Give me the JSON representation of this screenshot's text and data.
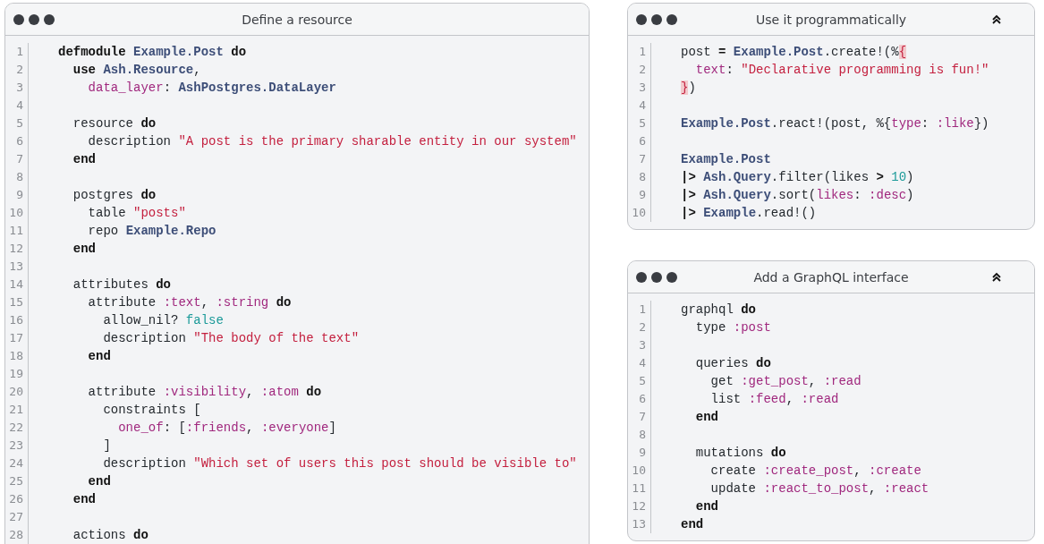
{
  "panels": [
    {
      "title": "Define a resource",
      "collapsible": false,
      "lines": [
        {
          "number": "1",
          "tokens": [
            {
              "kind": "keyword",
              "text": "defmodule "
            },
            {
              "kind": "module",
              "text": "Example.Post "
            },
            {
              "kind": "keyword",
              "text": "do"
            }
          ]
        },
        {
          "number": "2",
          "tokens": [
            {
              "kind": "keyword",
              "text": "  use "
            },
            {
              "kind": "module",
              "text": "Ash.Resource"
            },
            {
              "kind": "plain",
              "text": ","
            }
          ]
        },
        {
          "number": "3",
          "tokens": [
            {
              "kind": "atom",
              "text": "    data_layer"
            },
            {
              "kind": "plain",
              "text": ": "
            },
            {
              "kind": "module",
              "text": "AshPostgres.DataLayer"
            }
          ]
        },
        {
          "number": "4"
        },
        {
          "number": "5",
          "tokens": [
            {
              "kind": "plain",
              "text": "  resource "
            },
            {
              "kind": "keyword",
              "text": "do"
            }
          ]
        },
        {
          "number": "6",
          "tokens": [
            {
              "kind": "plain",
              "text": "    description "
            },
            {
              "kind": "string",
              "text": "\"A post is the primary sharable entity in our system\""
            }
          ]
        },
        {
          "number": "7",
          "tokens": [
            {
              "kind": "keyword",
              "text": "  end"
            }
          ]
        },
        {
          "number": "8"
        },
        {
          "number": "9",
          "tokens": [
            {
              "kind": "plain",
              "text": "  postgres "
            },
            {
              "kind": "keyword",
              "text": "do"
            }
          ]
        },
        {
          "number": "10",
          "tokens": [
            {
              "kind": "plain",
              "text": "    table "
            },
            {
              "kind": "string",
              "text": "\"posts\""
            }
          ]
        },
        {
          "number": "11",
          "tokens": [
            {
              "kind": "plain",
              "text": "    repo "
            },
            {
              "kind": "module",
              "text": "Example.Repo"
            }
          ]
        },
        {
          "number": "12",
          "tokens": [
            {
              "kind": "keyword",
              "text": "  end"
            }
          ]
        },
        {
          "number": "13"
        },
        {
          "number": "14",
          "tokens": [
            {
              "kind": "plain",
              "text": "  attributes "
            },
            {
              "kind": "keyword",
              "text": "do"
            }
          ]
        },
        {
          "number": "15",
          "tokens": [
            {
              "kind": "plain",
              "text": "    attribute "
            },
            {
              "kind": "atom",
              "text": ":text"
            },
            {
              "kind": "plain",
              "text": ", "
            },
            {
              "kind": "atom",
              "text": ":string "
            },
            {
              "kind": "keyword",
              "text": "do"
            }
          ]
        },
        {
          "number": "16",
          "tokens": [
            {
              "kind": "plain",
              "text": "      allow_nil? "
            },
            {
              "kind": "number",
              "text": "false"
            }
          ]
        },
        {
          "number": "17",
          "tokens": [
            {
              "kind": "plain",
              "text": "      description "
            },
            {
              "kind": "string",
              "text": "\"The body of the text\""
            }
          ]
        },
        {
          "number": "18",
          "tokens": [
            {
              "kind": "keyword",
              "text": "    end"
            }
          ]
        },
        {
          "number": "19"
        },
        {
          "number": "20",
          "tokens": [
            {
              "kind": "plain",
              "text": "    attribute "
            },
            {
              "kind": "atom",
              "text": ":visibility"
            },
            {
              "kind": "plain",
              "text": ", "
            },
            {
              "kind": "atom",
              "text": ":atom "
            },
            {
              "kind": "keyword",
              "text": "do"
            }
          ]
        },
        {
          "number": "21",
          "tokens": [
            {
              "kind": "plain",
              "text": "      constraints ["
            }
          ]
        },
        {
          "number": "22",
          "tokens": [
            {
              "kind": "atom",
              "text": "        one_of"
            },
            {
              "kind": "plain",
              "text": ": ["
            },
            {
              "kind": "atom",
              "text": ":friends"
            },
            {
              "kind": "plain",
              "text": ", "
            },
            {
              "kind": "atom",
              "text": ":everyone"
            },
            {
              "kind": "plain",
              "text": "]"
            }
          ]
        },
        {
          "number": "23",
          "tokens": [
            {
              "kind": "plain",
              "text": "      ]"
            }
          ]
        },
        {
          "number": "24",
          "tokens": [
            {
              "kind": "plain",
              "text": "      description "
            },
            {
              "kind": "string",
              "text": "\"Which set of users this post should be visible to\""
            }
          ]
        },
        {
          "number": "25",
          "tokens": [
            {
              "kind": "keyword",
              "text": "    end"
            }
          ]
        },
        {
          "number": "26",
          "tokens": [
            {
              "kind": "keyword",
              "text": "  end"
            }
          ]
        },
        {
          "number": "27"
        },
        {
          "number": "28",
          "tokens": [
            {
              "kind": "plain",
              "text": "  actions "
            },
            {
              "kind": "keyword",
              "text": "do"
            }
          ]
        }
      ]
    },
    {
      "title": "Use it programmatically",
      "collapsible": true,
      "lines": [
        {
          "number": "1",
          "tokens": [
            {
              "kind": "plain",
              "text": "post "
            },
            {
              "kind": "keyword",
              "text": "= "
            },
            {
              "kind": "module",
              "text": "Example.Post"
            },
            {
              "kind": "plain",
              "text": ".create!(%"
            },
            {
              "kind": "bracket",
              "text": "{"
            }
          ]
        },
        {
          "number": "2",
          "tokens": [
            {
              "kind": "atom",
              "text": "  text"
            },
            {
              "kind": "plain",
              "text": ": "
            },
            {
              "kind": "string",
              "text": "\"Declarative programming is fun!\""
            }
          ]
        },
        {
          "number": "3",
          "tokens": [
            {
              "kind": "bracket",
              "text": "}"
            },
            {
              "kind": "plain",
              "text": ")"
            }
          ]
        },
        {
          "number": "4"
        },
        {
          "number": "5",
          "tokens": [
            {
              "kind": "module",
              "text": "Example.Post"
            },
            {
              "kind": "plain",
              "text": ".react!(post, %{"
            },
            {
              "kind": "atom",
              "text": "type"
            },
            {
              "kind": "plain",
              "text": ": "
            },
            {
              "kind": "atom",
              "text": ":like"
            },
            {
              "kind": "plain",
              "text": "})"
            }
          ]
        },
        {
          "number": "6"
        },
        {
          "number": "7",
          "tokens": [
            {
              "kind": "module",
              "text": "Example.Post"
            }
          ]
        },
        {
          "number": "8",
          "tokens": [
            {
              "kind": "keyword",
              "text": "|> "
            },
            {
              "kind": "module",
              "text": "Ash.Query"
            },
            {
              "kind": "plain",
              "text": ".filter(likes "
            },
            {
              "kind": "keyword",
              "text": "> "
            },
            {
              "kind": "number",
              "text": "10"
            },
            {
              "kind": "plain",
              "text": ")"
            }
          ]
        },
        {
          "number": "9",
          "tokens": [
            {
              "kind": "keyword",
              "text": "|> "
            },
            {
              "kind": "module",
              "text": "Ash.Query"
            },
            {
              "kind": "plain",
              "text": ".sort("
            },
            {
              "kind": "atom",
              "text": "likes"
            },
            {
              "kind": "plain",
              "text": ": "
            },
            {
              "kind": "atom",
              "text": ":desc"
            },
            {
              "kind": "plain",
              "text": ")"
            }
          ]
        },
        {
          "number": "10",
          "tokens": [
            {
              "kind": "keyword",
              "text": "|> "
            },
            {
              "kind": "module",
              "text": "Example"
            },
            {
              "kind": "plain",
              "text": ".read!()"
            }
          ]
        }
      ]
    },
    {
      "title": "Add a GraphQL interface",
      "collapsible": true,
      "lines": [
        {
          "number": "1",
          "tokens": [
            {
              "kind": "plain",
              "text": "graphql "
            },
            {
              "kind": "keyword",
              "text": "do"
            }
          ]
        },
        {
          "number": "2",
          "tokens": [
            {
              "kind": "plain",
              "text": "  type "
            },
            {
              "kind": "atom",
              "text": ":post"
            }
          ]
        },
        {
          "number": "3"
        },
        {
          "number": "4",
          "tokens": [
            {
              "kind": "plain",
              "text": "  queries "
            },
            {
              "kind": "keyword",
              "text": "do"
            }
          ]
        },
        {
          "number": "5",
          "tokens": [
            {
              "kind": "plain",
              "text": "    get "
            },
            {
              "kind": "atom",
              "text": ":get_post"
            },
            {
              "kind": "plain",
              "text": ", "
            },
            {
              "kind": "atom",
              "text": ":read"
            }
          ]
        },
        {
          "number": "6",
          "tokens": [
            {
              "kind": "plain",
              "text": "    list "
            },
            {
              "kind": "atom",
              "text": ":feed"
            },
            {
              "kind": "plain",
              "text": ", "
            },
            {
              "kind": "atom",
              "text": ":read"
            }
          ]
        },
        {
          "number": "7",
          "tokens": [
            {
              "kind": "keyword",
              "text": "  end"
            }
          ]
        },
        {
          "number": "8"
        },
        {
          "number": "9",
          "tokens": [
            {
              "kind": "plain",
              "text": "  mutations "
            },
            {
              "kind": "keyword",
              "text": "do"
            }
          ]
        },
        {
          "number": "10",
          "tokens": [
            {
              "kind": "plain",
              "text": "    create "
            },
            {
              "kind": "atom",
              "text": ":create_post"
            },
            {
              "kind": "plain",
              "text": ", "
            },
            {
              "kind": "atom",
              "text": ":create"
            }
          ]
        },
        {
          "number": "11",
          "tokens": [
            {
              "kind": "plain",
              "text": "    update "
            },
            {
              "kind": "atom",
              "text": ":react_to_post"
            },
            {
              "kind": "plain",
              "text": ", "
            },
            {
              "kind": "atom",
              "text": ":react"
            }
          ]
        },
        {
          "number": "12",
          "tokens": [
            {
              "kind": "keyword",
              "text": "  end"
            }
          ]
        },
        {
          "number": "13",
          "tokens": [
            {
              "kind": "keyword",
              "text": "end"
            }
          ]
        }
      ]
    }
  ]
}
